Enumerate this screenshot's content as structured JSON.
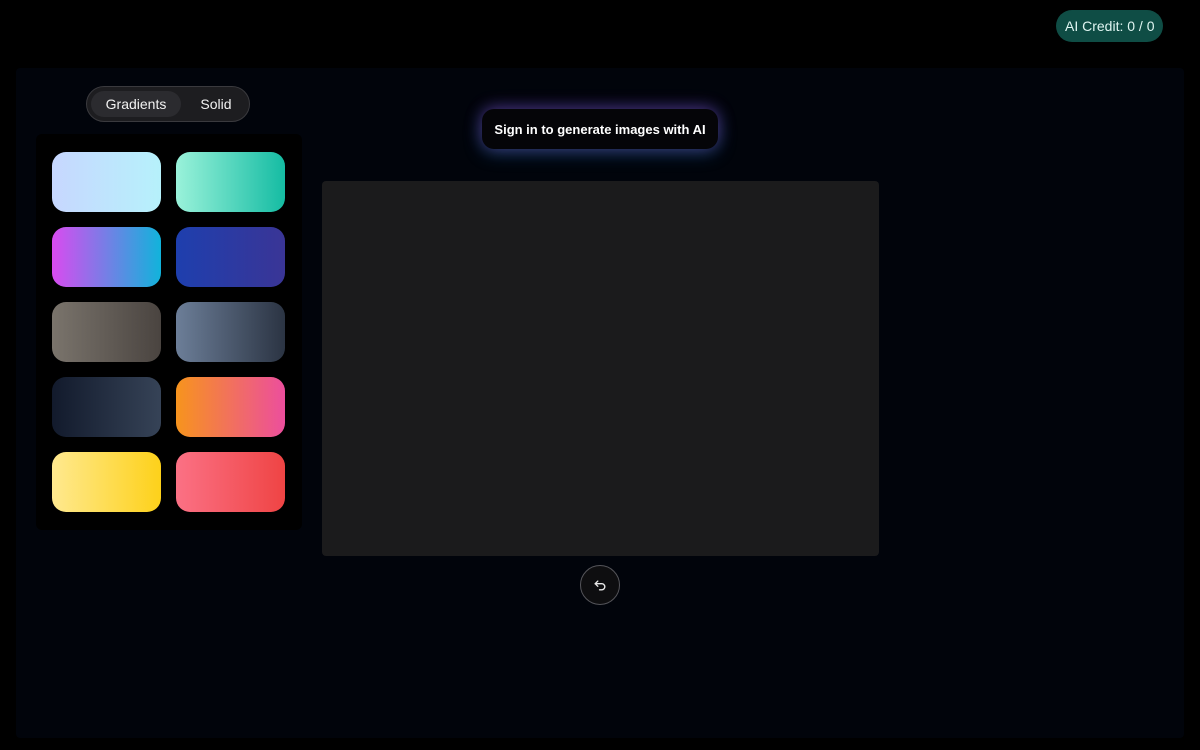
{
  "header": {
    "credit_label": "AI Credit: 0 / 0",
    "credit_color": "#0f4d45"
  },
  "toggle": {
    "options": [
      {
        "label": "Gradients",
        "active": true
      },
      {
        "label": "Solid",
        "active": false
      }
    ]
  },
  "swatches": [
    {
      "name": "light-blue",
      "colors": [
        "#c7d7ff",
        "#b6f1fb"
      ]
    },
    {
      "name": "mint-teal",
      "colors": [
        "#9af2da",
        "#15bca3"
      ]
    },
    {
      "name": "purple-cyan",
      "colors": [
        "#d94bf0",
        "#11b3db"
      ]
    },
    {
      "name": "deep-blue",
      "colors": [
        "#1e3fae",
        "#3a3596"
      ]
    },
    {
      "name": "warm-gray",
      "colors": [
        "#7a746c",
        "#4a4440"
      ]
    },
    {
      "name": "slate",
      "colors": [
        "#6c7e98",
        "#2b3443"
      ]
    },
    {
      "name": "dark-navy",
      "colors": [
        "#121a2c",
        "#364357"
      ]
    },
    {
      "name": "orange-pink",
      "colors": [
        "#f7941d",
        "#ec4e9d"
      ]
    },
    {
      "name": "yellow",
      "colors": [
        "#ffe98f",
        "#fdd11a"
      ]
    },
    {
      "name": "coral-red",
      "colors": [
        "#fb7185",
        "#ef4444"
      ]
    }
  ],
  "ai_prompt": {
    "label": "Sign in to generate images with AI"
  },
  "canvas": {
    "background": "#1b1b1c"
  },
  "controls": {
    "undo_icon": "undo-icon"
  }
}
